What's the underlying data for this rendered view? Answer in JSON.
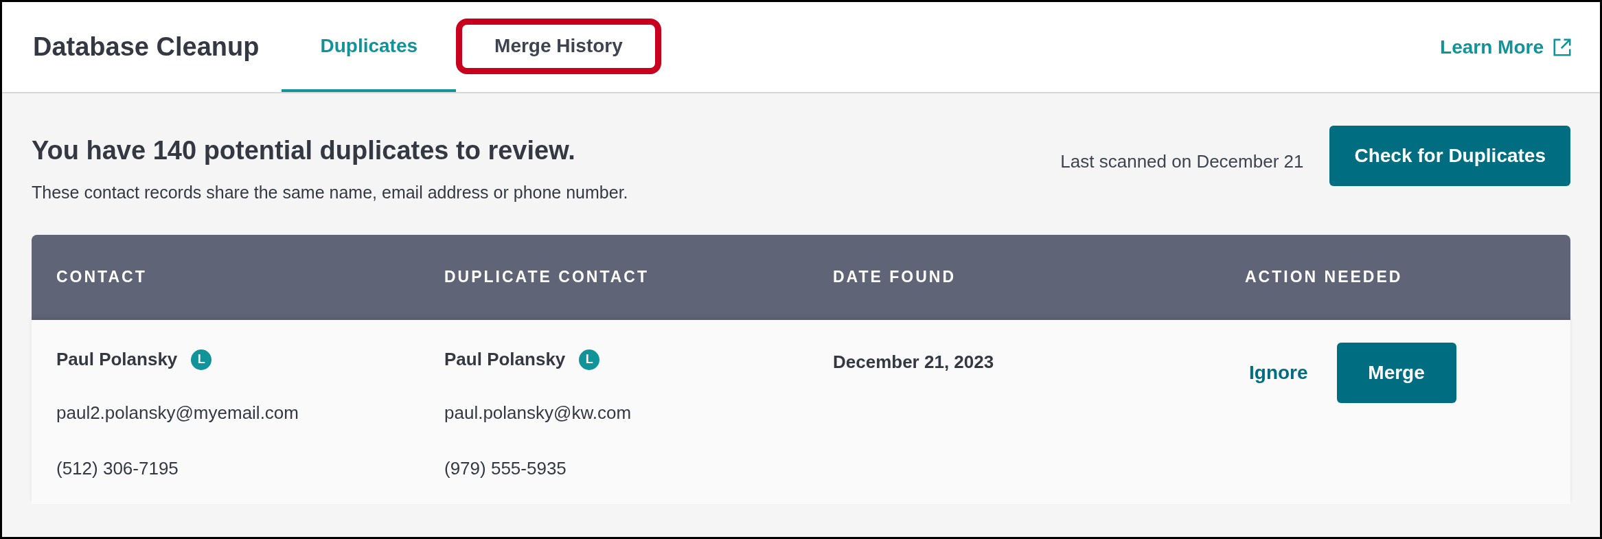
{
  "header": {
    "title": "Database Cleanup",
    "tabs": [
      {
        "label": "Duplicates",
        "selected": true,
        "highlighted": false
      },
      {
        "label": "Merge History",
        "selected": false,
        "highlighted": true
      }
    ],
    "link": "Learn More"
  },
  "summary": {
    "heading": "You have 140 potential duplicates to review.",
    "description": "These contact records share the same name, email address or phone number.",
    "last_scanned": "Last scanned on December 21",
    "button": "Check for Duplicates"
  },
  "table": {
    "columns": [
      "CONTACT",
      "DUPLICATE CONTACT",
      "DATE FOUND",
      "ACTION NEEDED"
    ],
    "rows": [
      {
        "contact": {
          "name": "Paul Polansky",
          "badge": "L",
          "email": "paul2.polansky@myemail.com",
          "phone": "(512) 306-7195"
        },
        "duplicate": {
          "name": "Paul Polansky",
          "badge": "L",
          "email": "paul.polansky@kw.com",
          "phone": "(979) 555-5935"
        },
        "date_found": "December 21, 2023",
        "actions": [
          "Ignore",
          "Merge"
        ]
      }
    ]
  }
}
